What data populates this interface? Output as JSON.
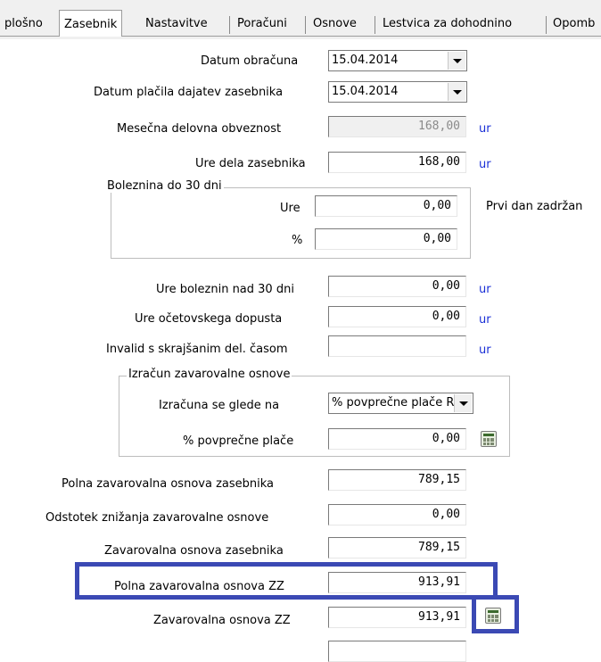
{
  "tabs": [
    {
      "label": "plošno"
    },
    {
      "label": "Zasebnik"
    },
    {
      "label": "Nastavitve"
    },
    {
      "label": "Poračuni"
    },
    {
      "label": "Osnove"
    },
    {
      "label": "Lestvica za dohodnino"
    },
    {
      "label": "Opomb"
    }
  ],
  "form": {
    "datum_obracuna": {
      "label": "Datum obračuna",
      "value": "15.04.2014"
    },
    "datum_placila": {
      "label": "Datum plačila dajatev zasebnika",
      "value": "15.04.2014"
    },
    "mesecna_obveznost": {
      "label": "Mesečna delovna obveznost",
      "value": "168,00",
      "unit": "ur"
    },
    "ure_dela": {
      "label": "Ure dela zasebnika",
      "value": "168,00",
      "unit": "ur"
    },
    "bolezen_group": {
      "title": "Boleznina do 30 dni",
      "ure_label": "Ure",
      "ure_value": "0,00",
      "pct_label": "%",
      "pct_value": "0,00",
      "side_label": "Prvi dan zadržan"
    },
    "bolezen_nad30": {
      "label": "Ure boleznin nad 30 dni",
      "value": "0,00",
      "unit": "ur"
    },
    "ocetovski": {
      "label": "Ure očetovskega dopusta",
      "value": "0,00",
      "unit": "ur"
    },
    "invalid": {
      "label": "Invalid s skrajšanim del. časom",
      "value": "",
      "unit": "ur"
    },
    "izracun_group": {
      "title": "Izračun zavarovalne osnove",
      "glede_label": "Izračuna se glede na",
      "glede_value": "% povprečne plače RS",
      "pct_label": "% povprečne plače",
      "pct_value": "0,00"
    },
    "polna_zasebnika": {
      "label": "Polna zavarovalna osnova zasebnika",
      "value": "789,15"
    },
    "odstotek": {
      "label": "Odstotek znižanja zavarovalne osnove",
      "value": "0,00"
    },
    "zav_zasebnika": {
      "label": "Zavarovalna osnova zasebnika",
      "value": "789,15"
    },
    "polna_zz": {
      "label": "Polna zavarovalna osnova ZZ",
      "value": "913,91"
    },
    "zav_zz": {
      "label": "Zavarovalna osnova ZZ",
      "value": "913,91"
    }
  },
  "colors": {
    "highlight": "#3b49b4",
    "unit": "#1a2fd6"
  }
}
